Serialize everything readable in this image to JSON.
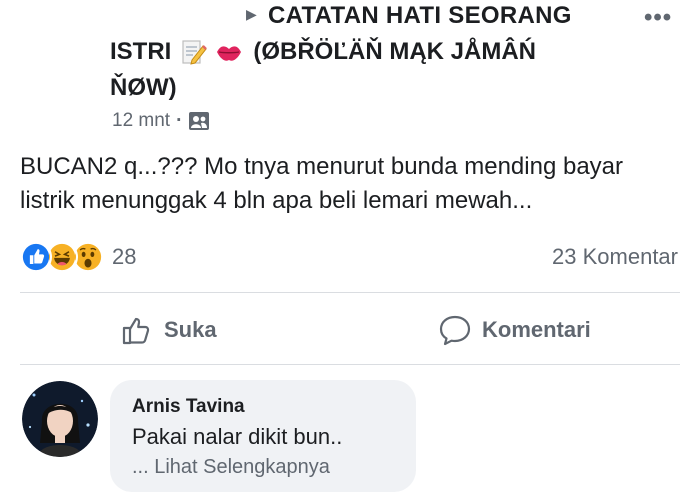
{
  "group": {
    "line1": "CATATAN HATI SEORANG",
    "line2": "ISTRI",
    "line2_suffix": "(ØBŘÖĽÄŇ MĄK JÅMÂŃ",
    "line3": "ŇØW)"
  },
  "meta": {
    "time": "12 mnt",
    "separator": "·"
  },
  "post": {
    "text": "BUCAN2 q...??? Mo tnya menurut bunda mending bayar listrik menunggak 4 bln apa beli lemari mewah..."
  },
  "stats": {
    "reaction_count": "28",
    "comment_count": "23 Komentar"
  },
  "actions": {
    "like": "Suka",
    "comment": "Komentari"
  },
  "comment": {
    "author": "Arnis Tavina",
    "text": "Pakai nalar dikit bun..",
    "see_more": "... Lihat Selengkapnya"
  },
  "icons": {
    "more": "more-options-icon",
    "audience": "group-members-icon",
    "reactions": [
      "like-reaction-icon",
      "haha-reaction-icon",
      "wow-reaction-icon"
    ],
    "like": "thumbs-up-icon",
    "comment": "comment-bubble-icon"
  },
  "colors": {
    "like_blue": "#1877f2",
    "reaction_yellow": "#f7b125",
    "text_secondary": "#606770"
  }
}
